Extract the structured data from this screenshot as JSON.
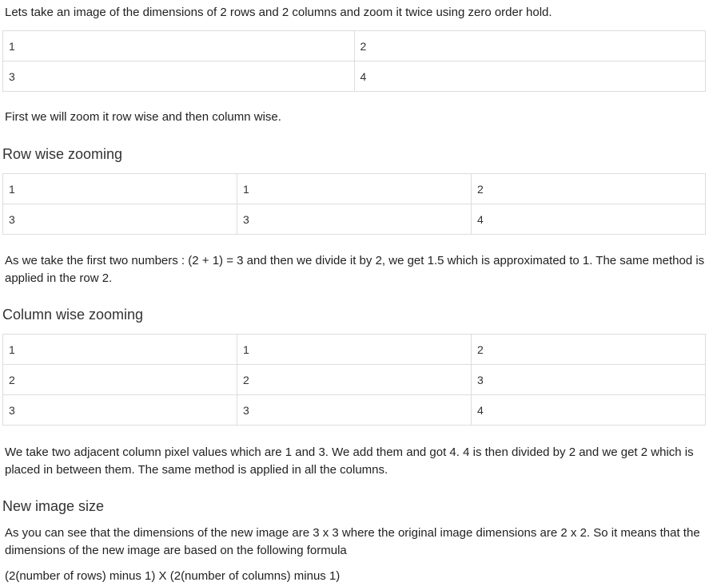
{
  "intro": "Lets take an image of the dimensions of 2 rows and 2 columns and zoom it twice using zero order hold.",
  "original_table": [
    [
      "1",
      "2"
    ],
    [
      "3",
      "4"
    ]
  ],
  "first_step": "First we will zoom it row wise and then column wise.",
  "row_heading": "Row wise zooming",
  "row_table": [
    [
      "1",
      "1",
      "2"
    ],
    [
      "3",
      "3",
      "4"
    ]
  ],
  "row_explanation": "As we take the first two numbers : (2 + 1) = 3 and then we divide it by 2, we get 1.5 which is approximated to 1. The same method is applied in the row 2.",
  "column_heading": "Column wise zooming",
  "column_table": [
    [
      "1",
      "1",
      "2"
    ],
    [
      "2",
      "2",
      "3"
    ],
    [
      "3",
      "3",
      "4"
    ]
  ],
  "column_explanation": "We take two adjacent column pixel values which are 1 and 3. We add them and got 4. 4 is then divided by 2 and we get 2 which is placed in between them. The same method is applied in all the columns.",
  "size_heading": "New image size",
  "size_explanation": "As you can see that the dimensions of the new image are 3 x 3 where the original image dimensions are 2 x 2. So it means that the dimensions of the new image are based on the following formula",
  "formula": "(2(number of rows) minus 1) X (2(number of columns) minus 1)"
}
